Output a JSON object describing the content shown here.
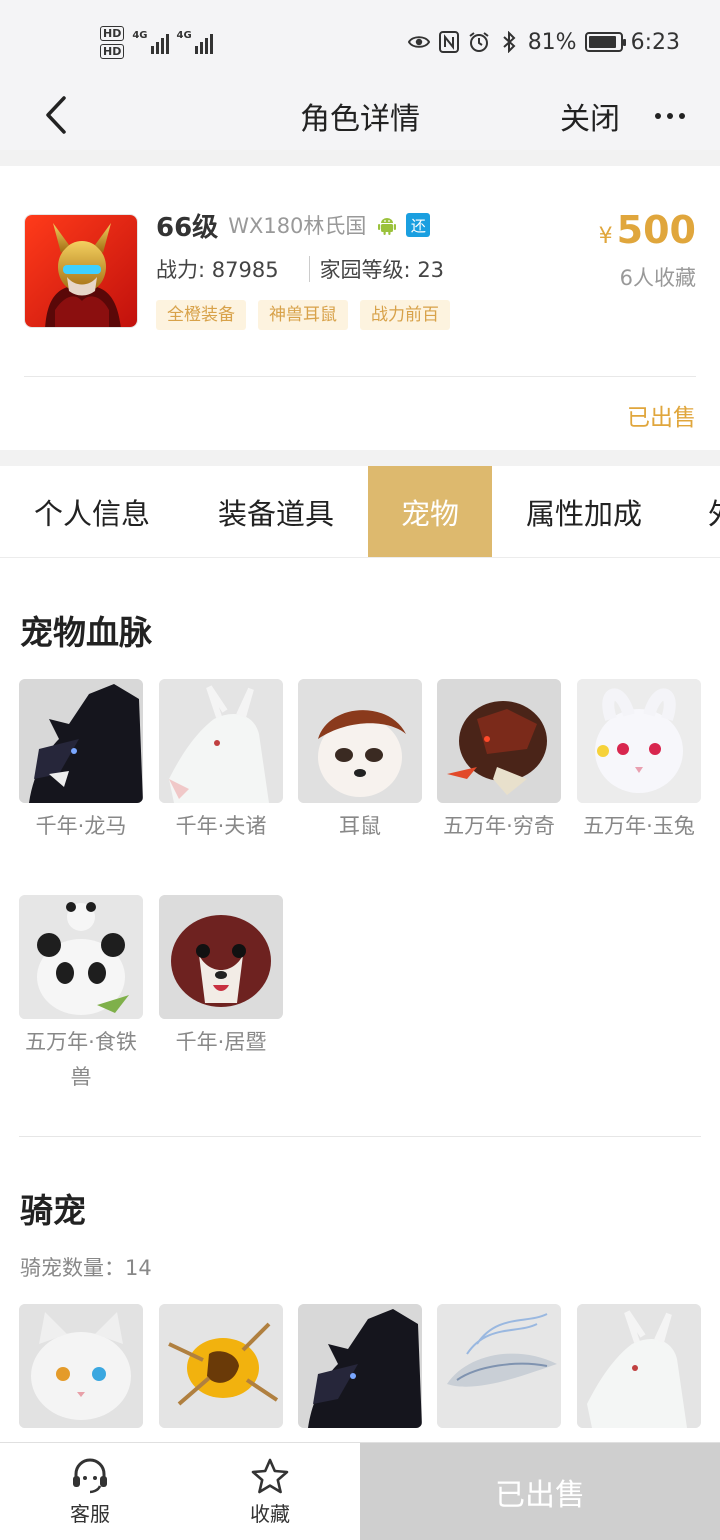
{
  "status_bar": {
    "sim1": "HD",
    "sim2": "HD",
    "net1": "4G",
    "net2": "4G",
    "battery": "81%",
    "time": "6:23",
    "icons": [
      "eye-icon",
      "nfc-icon",
      "alarm-icon",
      "bluetooth-icon"
    ]
  },
  "nav": {
    "title": "角色详情",
    "close_label": "关闭"
  },
  "role": {
    "level": "66级",
    "server": "WX180林氏国",
    "return_badge": "还",
    "combat": "战力: 87985",
    "home_level": "家园等级: 23",
    "tags": [
      "全橙装备",
      "神兽耳鼠",
      "战力前百"
    ],
    "currency": "¥",
    "price": "500",
    "favorites": "6人收藏",
    "status": "已出售"
  },
  "tabs": [
    "个人信息",
    "装备道具",
    "宠物",
    "属性加成",
    "外"
  ],
  "active_tab": 2,
  "pets_section": {
    "title": "宠物血脉",
    "items": [
      {
        "name": "千年·龙马",
        "icon": "black-dragon-horse"
      },
      {
        "name": "千年·夫诸",
        "icon": "white-deer"
      },
      {
        "name": "耳鼠",
        "icon": "ear-mouse"
      },
      {
        "name": "五万年·穷奇",
        "icon": "qiongqi-beast"
      },
      {
        "name": "五万年·玉兔",
        "icon": "jade-rabbit"
      },
      {
        "name": "五万年·食铁兽",
        "icon": "panda"
      },
      {
        "name": "千年·居暨",
        "icon": "red-weasel"
      }
    ]
  },
  "mounts_section": {
    "title": "骑宠",
    "count_label": "骑宠数量：",
    "count": "14",
    "items": [
      {
        "icon": "white-cat"
      },
      {
        "icon": "golden-beast"
      },
      {
        "icon": "black-dragon-horse"
      },
      {
        "icon": "crystal-fish"
      },
      {
        "icon": "white-deer"
      }
    ]
  },
  "bottom_bar": {
    "service_label": "客服",
    "favorite_label": "收藏",
    "sold_label": "已出售"
  }
}
